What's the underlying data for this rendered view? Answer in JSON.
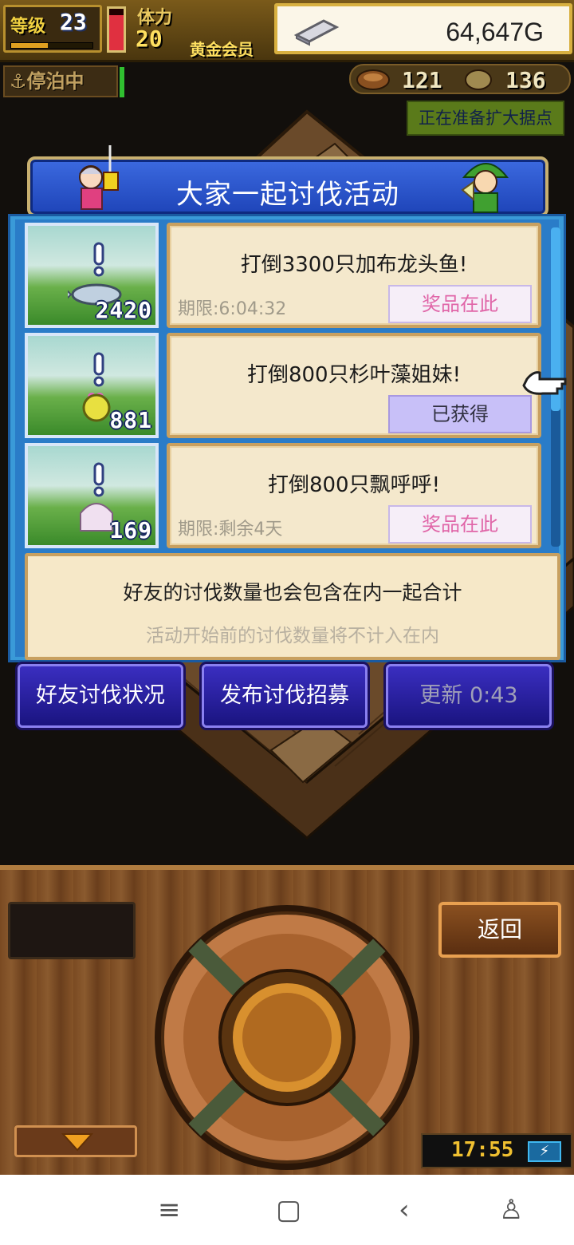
{
  "hud": {
    "level_label": "等级",
    "level": "23",
    "level_progress": 0.45,
    "hp_fill": 0.85,
    "stamina_label": "体力",
    "stamina": "20",
    "member": "黄金会员",
    "gold": "64,647G"
  },
  "status": {
    "docked": "停泊中",
    "resource_a": "121",
    "resource_b": "136",
    "expand_notice": "正在准备扩大据点"
  },
  "panel": {
    "title": "大家一起讨伐活动",
    "quests": [
      {
        "title": "打倒3300只加布龙头鱼!",
        "deadline": "期限:6:04:32",
        "button": "奖品在此",
        "count": "2420",
        "state": "available"
      },
      {
        "title": "打倒800只杉叶藻姐妹!",
        "deadline": "",
        "button": "已获得",
        "count": "881",
        "state": "claimed"
      },
      {
        "title": "打倒800只飘呼呼!",
        "deadline": "期限:剩余4天",
        "button": "奖品在此",
        "count": "169",
        "state": "available"
      }
    ],
    "notice_main": "好友的讨伐数量也会包含在内一起合计",
    "notice_sub": "活动开始前的讨伐数量将不计入在内"
  },
  "actions": {
    "friends_status": "好友讨伐状况",
    "post_recruit": "发布讨伐招募",
    "refresh": "更新 0:43"
  },
  "controls": {
    "back": "返回",
    "clock": "17:55"
  },
  "icons": {
    "nav": [
      "menu-icon",
      "home-icon",
      "back-icon",
      "accessibility-icon"
    ]
  }
}
